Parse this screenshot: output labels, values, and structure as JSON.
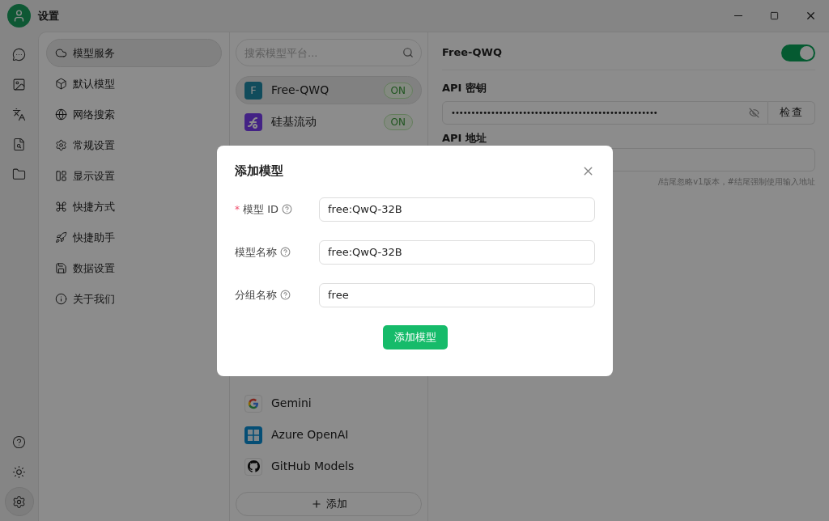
{
  "window": {
    "title": "设置"
  },
  "rail": [
    {
      "kind": "chat",
      "selected": false
    },
    {
      "kind": "image",
      "selected": false
    },
    {
      "kind": "translate",
      "selected": false
    },
    {
      "kind": "doc-search",
      "selected": false
    },
    {
      "kind": "folder",
      "selected": false
    }
  ],
  "rail_bottom": [
    {
      "kind": "help",
      "selected": false
    },
    {
      "kind": "sun",
      "selected": false
    },
    {
      "kind": "settings",
      "selected": true
    }
  ],
  "menu": [
    {
      "kind": "cloud",
      "label": "模型服务",
      "selected": true
    },
    {
      "kind": "cube",
      "label": "默认模型",
      "selected": false
    },
    {
      "kind": "globe",
      "label": "网络搜索",
      "selected": false
    },
    {
      "kind": "gear",
      "label": "常规设置",
      "selected": false
    },
    {
      "kind": "layout",
      "label": "显示设置",
      "selected": false
    },
    {
      "kind": "command",
      "label": "快捷方式",
      "selected": false
    },
    {
      "kind": "rocket",
      "label": "快捷助手",
      "selected": false
    },
    {
      "kind": "save",
      "label": "数据设置",
      "selected": false
    },
    {
      "kind": "info",
      "label": "关于我们",
      "selected": false
    }
  ],
  "providers": {
    "search": {
      "placeholder": "搜索模型平台..."
    },
    "top": [
      {
        "kind": "letter",
        "logo": "F",
        "name": "Free-QWQ",
        "badge": "ON",
        "selected": true
      },
      {
        "kind": "silicon",
        "name": "硅基流动",
        "badge": "ON",
        "selected": false
      }
    ],
    "bottom": [
      {
        "kind": "google",
        "name": "Gemini",
        "selected": false
      },
      {
        "kind": "azure",
        "name": "Azure OpenAI",
        "selected": false
      },
      {
        "kind": "github",
        "name": "GitHub Models",
        "selected": false
      }
    ],
    "add_button": "添加"
  },
  "detail": {
    "title": "Free-QWQ",
    "enabled": true,
    "api_key_label": "API 密钥",
    "api_key_value": "••••••••••••••••••••••••••••••••••••••••••••••••••••",
    "check_button": "检查",
    "api_url_label": "API 地址",
    "api_url_hint": "/结尾忽略v1版本，#结尾强制使用输入地址"
  },
  "dialog": {
    "title": "添加模型",
    "fields": [
      {
        "marker": "*",
        "label": "模型 ID",
        "value": "free:QwQ-32B"
      },
      {
        "label": "模型名称",
        "value": "free:QwQ-32B"
      },
      {
        "label": "分组名称",
        "value": "free"
      }
    ],
    "submit": "添加模型"
  }
}
